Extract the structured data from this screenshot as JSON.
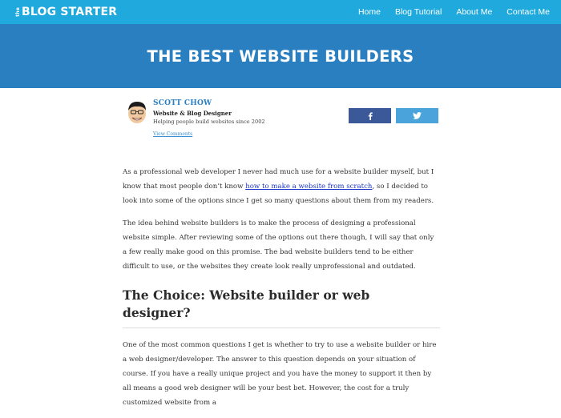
{
  "header": {
    "logo_the": "the",
    "logo_text": "BLOG STARTER",
    "nav": [
      {
        "label": "Home"
      },
      {
        "label": "Blog Tutorial"
      },
      {
        "label": "About Me"
      },
      {
        "label": "Contact Me"
      }
    ]
  },
  "hero": {
    "title": "THE BEST WEBSITE BUILDERS"
  },
  "author": {
    "name": "SCOTT CHOW",
    "role": "Website & Blog Designer",
    "tagline": "Helping people build websites since 2002",
    "comments_link": "View Comments"
  },
  "share": {
    "facebook_icon": "facebook-icon",
    "twitter_icon": "twitter-icon"
  },
  "article": {
    "p1_before": "As a professional web developer I never had much use for a website builder myself, but I know that most people don’t know ",
    "p1_link": "how to make a website from scratch",
    "p1_after": ", so I decided to look into some of the options since I get so many questions about them from my readers.",
    "p2": "The idea behind website builders is to make the process of designing a professional website simple.  After reviewing some of the options out there though, I will say that only a few really make good on this promise.  The bad website builders tend to be either difficult to use, or the websites they create look really unprofessional and outdated.",
    "section_heading": "The Choice: Website builder or web designer?",
    "p3": "One of the most common questions I get is whether to try to use a website builder or hire a web designer/developer.  The answer to this question depends on your situation of course.  If you have a really unique project and you have the money to support it then by all means a good web designer will be your best bet.  However, the cost for a truly customized website from a"
  },
  "colors": {
    "topbar": "#1fa9dc",
    "hero": "#2a7fc1",
    "facebook": "#3b5998",
    "twitter": "#4ba3dc",
    "link": "#1a35c9"
  }
}
